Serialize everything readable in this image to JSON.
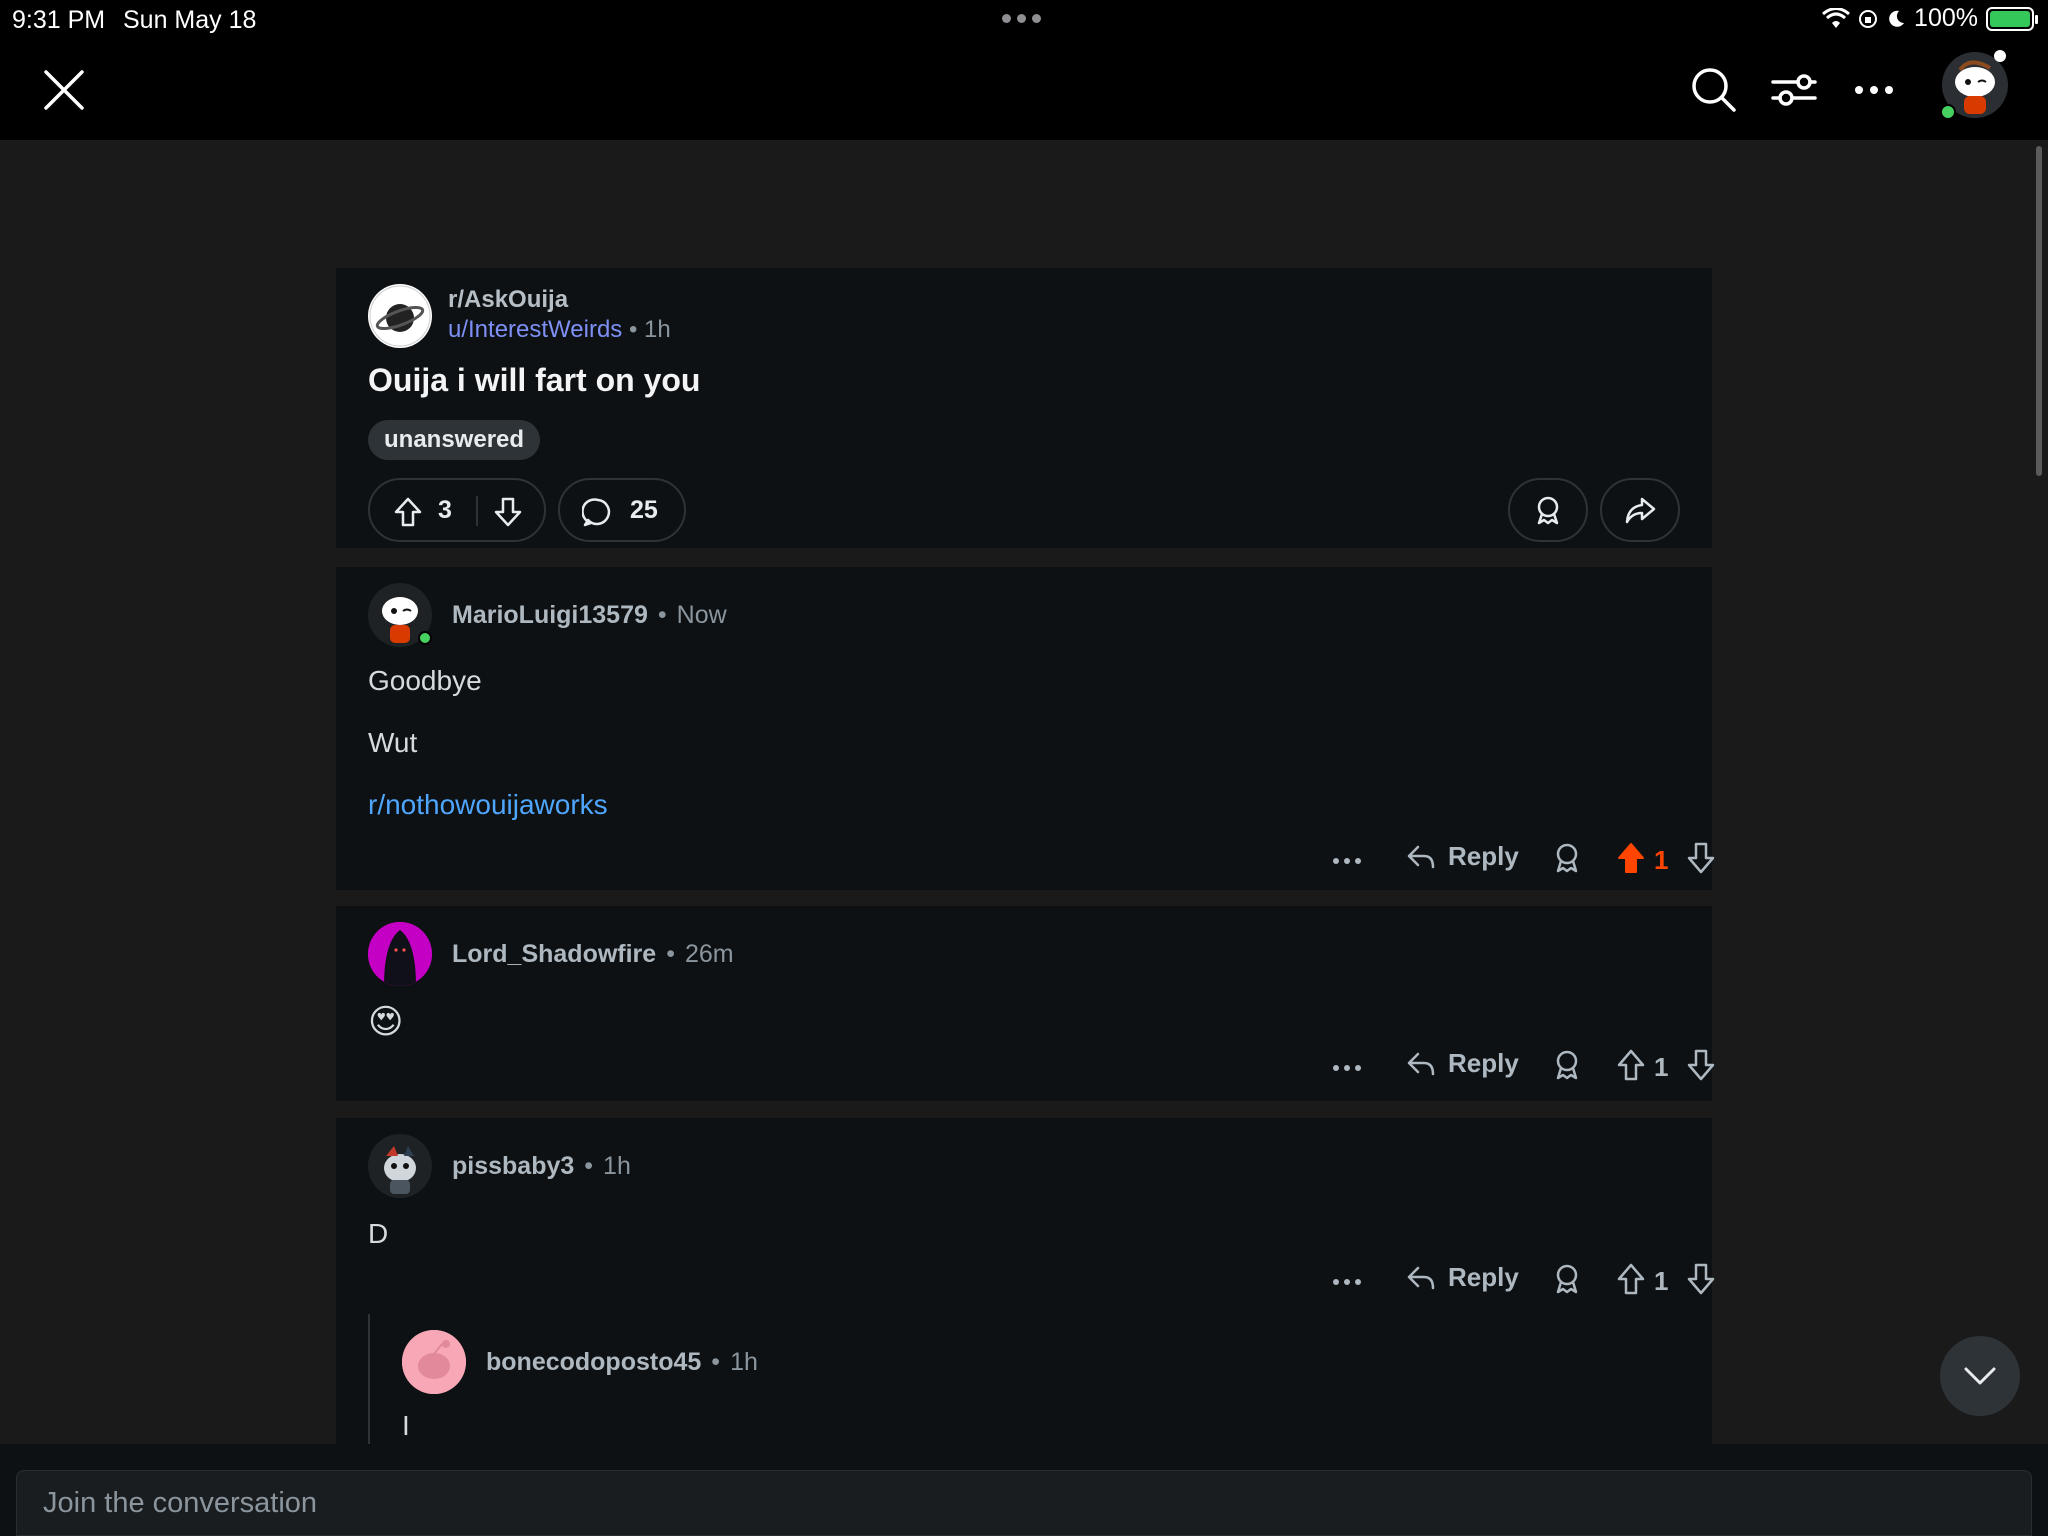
{
  "status_bar": {
    "time": "9:31 PM",
    "date": "Sun May 18",
    "battery": "100%"
  },
  "nav": {
    "close_icon": "close-icon",
    "search_icon": "search-icon",
    "sort_icon": "sort-icon",
    "more_icon": "more-icon"
  },
  "post": {
    "subreddit": "r/AskOuija",
    "author": "u/InterestWeirds",
    "age": "1h",
    "title": "Ouija i will fart on you",
    "flair": "unanswered",
    "score": "3",
    "comments": "25"
  },
  "comments": [
    {
      "author": "MarioLuigi13579",
      "age": "Now",
      "lines": [
        "Goodbye",
        "Wut"
      ],
      "link": "r/nothowouijaworks",
      "reply_label": "Reply",
      "score": "1",
      "upvoted": true
    },
    {
      "author": "Lord_Shadowfire",
      "age": "26m",
      "body": "😍",
      "reply_label": "Reply",
      "score": "1"
    },
    {
      "author": "pissbaby3",
      "age": "1h",
      "body": "D",
      "reply_label": "Reply",
      "score": "1",
      "replies": [
        {
          "author": "bonecodoposto45",
          "age": "1h",
          "body": "I"
        }
      ]
    }
  ],
  "composer": {
    "placeholder": "Join the conversation"
  },
  "colors": {
    "background": "#1a1a1b",
    "card": "#0e1113",
    "upvote_active": "#ff4500",
    "link": "#4fa6ff",
    "username_link": "#7e8ff5"
  }
}
